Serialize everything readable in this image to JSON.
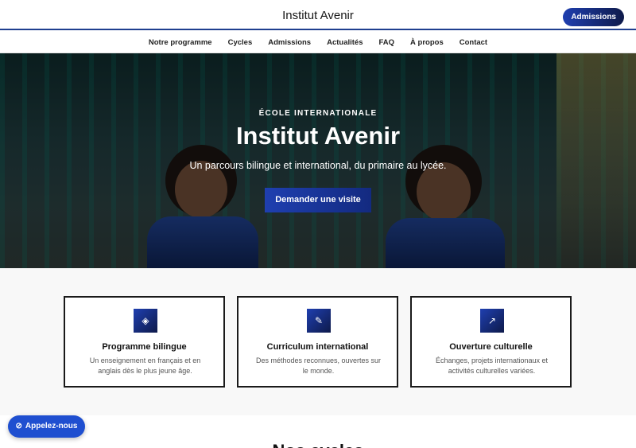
{
  "header": {
    "brand": "Institut Avenir",
    "admissions_label": "Admissions"
  },
  "nav": {
    "items": [
      {
        "label": "Notre programme"
      },
      {
        "label": "Cycles"
      },
      {
        "label": "Admissions"
      },
      {
        "label": "Actualités"
      },
      {
        "label": "FAQ"
      },
      {
        "label": "À propos"
      },
      {
        "label": "Contact"
      }
    ]
  },
  "hero": {
    "eyebrow": "ÉCOLE INTERNATIONALE",
    "title": "Institut Avenir",
    "subtitle": "Un parcours bilingue et international, du primaire au lycée.",
    "cta_label": "Demander une visite"
  },
  "features": [
    {
      "icon": "translate-icon",
      "glyph": "◈",
      "title": "Programme bilingue",
      "desc": "Un enseignement en français et en anglais dès le plus jeune âge."
    },
    {
      "icon": "pencil-icon",
      "glyph": "✎",
      "title": "Curriculum international",
      "desc": "Des méthodes reconnues, ouvertes sur le monde."
    },
    {
      "icon": "arrow-up-right-icon",
      "glyph": "↗",
      "title": "Ouverture culturelle",
      "desc": "Échanges, projets internationaux et activités culturelles variées."
    }
  ],
  "next_section": {
    "title": "Nos cycles"
  },
  "call_button": {
    "glyph": "⊘",
    "label": "Appelez-nous"
  },
  "colors": {
    "accent": "#1f3fb0",
    "dark": "#0e1a4a",
    "call": "#1f4fd0"
  }
}
